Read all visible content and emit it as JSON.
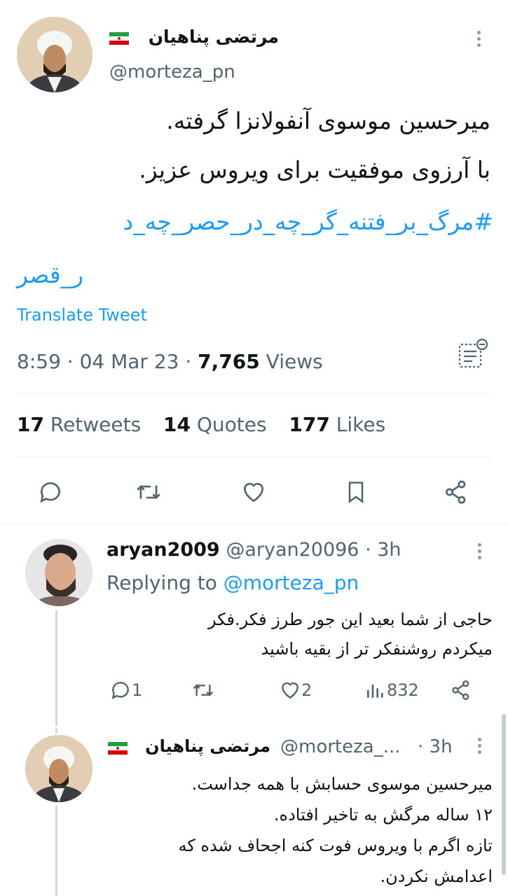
{
  "main_tweet": {
    "author_name": "مرتضی پناهیان",
    "handle": "@morteza_pn",
    "text_line1": "میرحسین موسوی آنفولانزا گرفته.",
    "text_line2": "با آرزوی موفقیت برای ویروس عزیز.",
    "hashtag_line1": "#مرگ_بر_فتنه_گر_چه_در_حصر_چه_د",
    "hashtag_line2": "ر_قصر",
    "translate": "Translate Tweet",
    "time": "8:59 · 04 Mar 23 · ",
    "views_count": "7,765",
    "views_label": " Views",
    "retweets_count": "17",
    "retweets_label": " Retweets",
    "quotes_count": "14",
    "quotes_label": " Quotes",
    "likes_count": "177",
    "likes_label": " Likes"
  },
  "reply1": {
    "name": "aryan2009",
    "handle_time": " @aryan20096 · 3h",
    "replying_prefix": "Replying to ",
    "replying_handle": "@morteza_pn",
    "line1": "حاجی از شما بعید این جور طرز فکر.فکر",
    "line2": "میکردم روشنفکر تر از بقیه باشید",
    "reply_count": "1",
    "like_count": "2",
    "views_count": "832"
  },
  "reply2": {
    "name": "مرتضی پناهیان",
    "handle": "@morteza_...",
    "time": "· 3h",
    "line1": "میرحسین موسوی حسابش با همه جداست.",
    "line2": "۱۲ ساله مرگش به تاخیر افتاده.",
    "line3": "تازه اگرم با ویروس فوت کنه اجحاف شده که",
    "line4": "اعدامش نکردن."
  },
  "icons": [
    "reply-icon",
    "retweet-icon",
    "like-icon",
    "bookmark-icon",
    "share-icon",
    "views-icon",
    "more-icon",
    "flag-icon",
    "analytics-icon"
  ],
  "colors": {
    "accent": "#1d9bf0",
    "text": "#0f1419",
    "secondary": "#536471",
    "divider": "#eff3f4"
  }
}
